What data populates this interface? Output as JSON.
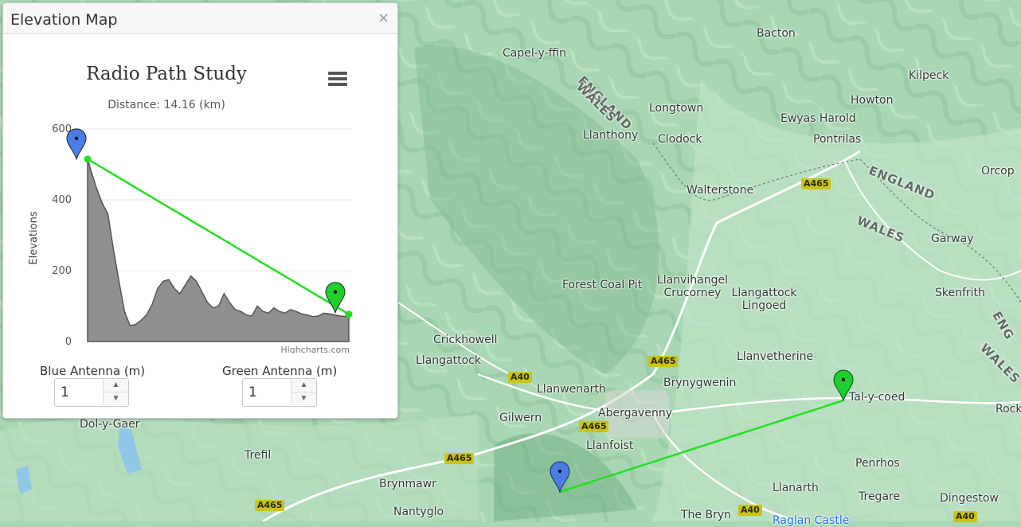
{
  "dialog": {
    "title": "Elevation Map",
    "close_icon": "×"
  },
  "chart_data": {
    "type": "area",
    "title": "Radio Path Study",
    "subtitle": "Distance: 14.16 (km)",
    "ylabel": "Elevations",
    "ylim": [
      0,
      600
    ],
    "yticks": [
      "0",
      "200",
      "400",
      "600"
    ],
    "credits": "Highcharts.com",
    "series": [
      {
        "name": "",
        "x": [
          0,
          0.2,
          0.5,
          0.8,
          1.1,
          1.4,
          1.7,
          2.0,
          2.3,
          2.6,
          2.9,
          3.2,
          3.5,
          3.8,
          4.1,
          4.4,
          4.7,
          5.0,
          5.3,
          5.6,
          5.9,
          6.2,
          6.5,
          6.8,
          7.1,
          7.4,
          7.7,
          8.0,
          8.3,
          8.6,
          8.9,
          9.2,
          9.5,
          9.8,
          10.1,
          10.4,
          10.7,
          11.0,
          11.3,
          11.6,
          11.9,
          12.2,
          12.5,
          12.8,
          13.1,
          13.4,
          13.7,
          14.16
        ],
        "values": [
          515,
          480,
          430,
          390,
          360,
          260,
          170,
          85,
          45,
          48,
          60,
          75,
          105,
          150,
          170,
          175,
          150,
          135,
          160,
          185,
          170,
          140,
          110,
          95,
          100,
          135,
          110,
          90,
          85,
          75,
          72,
          100,
          85,
          80,
          95,
          85,
          80,
          90,
          85,
          78,
          75,
          70,
          72,
          80,
          78,
          75,
          72,
          70
        ]
      },
      {
        "name": "",
        "x": [
          0,
          14.16
        ],
        "values": [
          515,
          77
        ]
      }
    ],
    "markers": [
      {
        "icon": "blue-pin-icon",
        "color": "#4a7de8",
        "x": 0,
        "y": 515
      },
      {
        "icon": "green-pin-icon",
        "color": "#1fcf2f",
        "x": 14.16,
        "y": 77
      }
    ],
    "colors": {
      "area": "#8f8f8f",
      "area_stroke": "#555555",
      "line": "#22e022"
    }
  },
  "antennas": {
    "blue_label": "Blue Antenna (m)",
    "blue_value": "1",
    "green_label": "Green Antenna (m)",
    "green_value": "1"
  },
  "map": {
    "places": [
      "Bacton",
      "Capel-y-ffin",
      "Kilpeck",
      "Longtown",
      "Howton",
      "Ewyas Harold",
      "Llanthony",
      "Clodock",
      "Pontrilas",
      "Orcop",
      "Walterstone",
      "Garway",
      "Forest Coal Pit",
      "Llanvihangel Crucorney",
      "Llangattock Lingoed",
      "Skenfrith",
      "Crickhowell",
      "Llangattock",
      "Llanvetherine",
      "Brynygwenin",
      "Llanwenarth",
      "Abergavenny",
      "Tal-y-coed",
      "Gilwern",
      "Llanfoist",
      "Rock",
      "Dol-y-Gaer",
      "Trefil",
      "Brynmawr",
      "Penrhos",
      "Llanarth",
      "Tregare",
      "Dingestow",
      "Nantyglo",
      "The Bryn",
      "Raglan Castle"
    ],
    "regions": [
      "ENGLAND",
      "WALES",
      "ENGLAND",
      "WALES",
      "ENG",
      "WALES"
    ],
    "roads": [
      "A465",
      "A465",
      "A40",
      "A465",
      "A465",
      "A465",
      "A40",
      "A40"
    ],
    "path_color": "#22e022",
    "blue_pin_color": "#4a7de8",
    "green_pin_color": "#1fcf2f"
  }
}
